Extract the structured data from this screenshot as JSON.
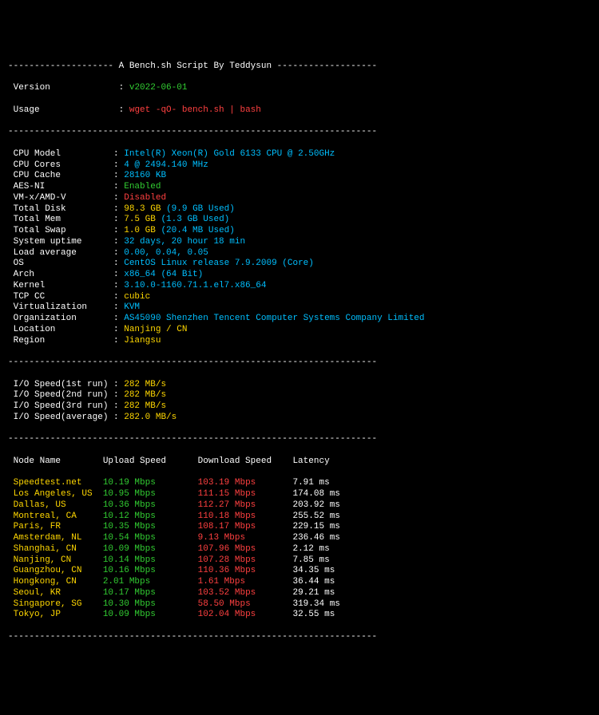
{
  "banner": {
    "title_prefix": "-------------------- ",
    "title": "A Bench.sh Script By Teddysun",
    "title_suffix": " -------------------",
    "version_label": " Version",
    "version_value": "v2022-06-01",
    "usage_label": " Usage",
    "usage_value": "wget -qO- bench.sh | bash"
  },
  "divider": "----------------------------------------------------------------------",
  "sys": [
    {
      "label": " CPU Model",
      "value": "Intel(R) Xeon(R) Gold 6133 CPU @ 2.50GHz",
      "color": "cyan"
    },
    {
      "label": " CPU Cores",
      "value": "4 @ 2494.140 MHz",
      "color": "cyan"
    },
    {
      "label": " CPU Cache",
      "value": "28160 KB",
      "color": "cyan"
    },
    {
      "label": " AES-NI",
      "value": "Enabled",
      "color": "green"
    },
    {
      "label": " VM-x/AMD-V",
      "value": "Disabled",
      "color": "red"
    },
    {
      "label": " Total Disk",
      "value": "98.3 GB",
      "extra": "(9.9 GB Used)",
      "color": "yellow"
    },
    {
      "label": " Total Mem",
      "value": "7.5 GB",
      "extra": "(1.3 GB Used)",
      "color": "yellow"
    },
    {
      "label": " Total Swap",
      "value": "1.0 GB",
      "extra": "(20.4 MB Used)",
      "color": "yellow"
    },
    {
      "label": " System uptime",
      "value": "32 days, 20 hour 18 min",
      "color": "cyan"
    },
    {
      "label": " Load average",
      "value": "0.00, 0.04, 0.05",
      "color": "cyan"
    },
    {
      "label": " OS",
      "value": "CentOS Linux release 7.9.2009 (Core)",
      "color": "cyan"
    },
    {
      "label": " Arch",
      "value": "x86_64 (64 Bit)",
      "color": "cyan"
    },
    {
      "label": " Kernel",
      "value": "3.10.0-1160.71.1.el7.x86_64",
      "color": "cyan"
    },
    {
      "label": " TCP CC",
      "value": "cubic",
      "color": "yellow"
    },
    {
      "label": " Virtualization",
      "value": "KVM",
      "color": "cyan"
    },
    {
      "label": " Organization",
      "value": "AS45090 Shenzhen Tencent Computer Systems Company Limited",
      "color": "cyan"
    },
    {
      "label": " Location",
      "value": "Nanjing / CN",
      "color": "yellow"
    },
    {
      "label": " Region",
      "value": "Jiangsu",
      "color": "yellow"
    }
  ],
  "io": [
    {
      "label": " I/O Speed(1st run)",
      "value": "282 MB/s"
    },
    {
      "label": " I/O Speed(2nd run)",
      "value": "282 MB/s"
    },
    {
      "label": " I/O Speed(3rd run)",
      "value": "282 MB/s"
    },
    {
      "label": " I/O Speed(average)",
      "value": "282.0 MB/s"
    }
  ],
  "net_header": {
    "node": " Node Name",
    "up": "Upload Speed",
    "down": "Download Speed",
    "lat": "Latency"
  },
  "net": [
    {
      "node": " Speedtest.net",
      "up": "10.19 Mbps",
      "down": "103.19 Mbps",
      "lat": "7.91 ms"
    },
    {
      "node": " Los Angeles, US",
      "up": "10.95 Mbps",
      "down": "111.15 Mbps",
      "lat": "174.08 ms"
    },
    {
      "node": " Dallas, US",
      "up": "10.36 Mbps",
      "down": "112.27 Mbps",
      "lat": "203.92 ms"
    },
    {
      "node": " Montreal, CA",
      "up": "10.12 Mbps",
      "down": "110.18 Mbps",
      "lat": "255.52 ms"
    },
    {
      "node": " Paris, FR",
      "up": "10.35 Mbps",
      "down": "108.17 Mbps",
      "lat": "229.15 ms"
    },
    {
      "node": " Amsterdam, NL",
      "up": "10.54 Mbps",
      "down": "9.13 Mbps",
      "lat": "236.46 ms"
    },
    {
      "node": " Shanghai, CN",
      "up": "10.09 Mbps",
      "down": "107.96 Mbps",
      "lat": "2.12 ms"
    },
    {
      "node": " Nanjing, CN",
      "up": "10.14 Mbps",
      "down": "107.28 Mbps",
      "lat": "7.85 ms"
    },
    {
      "node": " Guangzhou, CN",
      "up": "10.16 Mbps",
      "down": "110.36 Mbps",
      "lat": "34.35 ms"
    },
    {
      "node": " Hongkong, CN",
      "up": "2.01 Mbps",
      "down": "1.61 Mbps",
      "lat": "36.44 ms"
    },
    {
      "node": " Seoul, KR",
      "up": "10.17 Mbps",
      "down": "103.52 Mbps",
      "lat": "29.21 ms"
    },
    {
      "node": " Singapore, SG",
      "up": "10.30 Mbps",
      "down": "58.50 Mbps",
      "lat": "319.34 ms"
    },
    {
      "node": " Tokyo, JP",
      "up": "10.09 Mbps",
      "down": "102.04 Mbps",
      "lat": "32.55 ms"
    }
  ]
}
